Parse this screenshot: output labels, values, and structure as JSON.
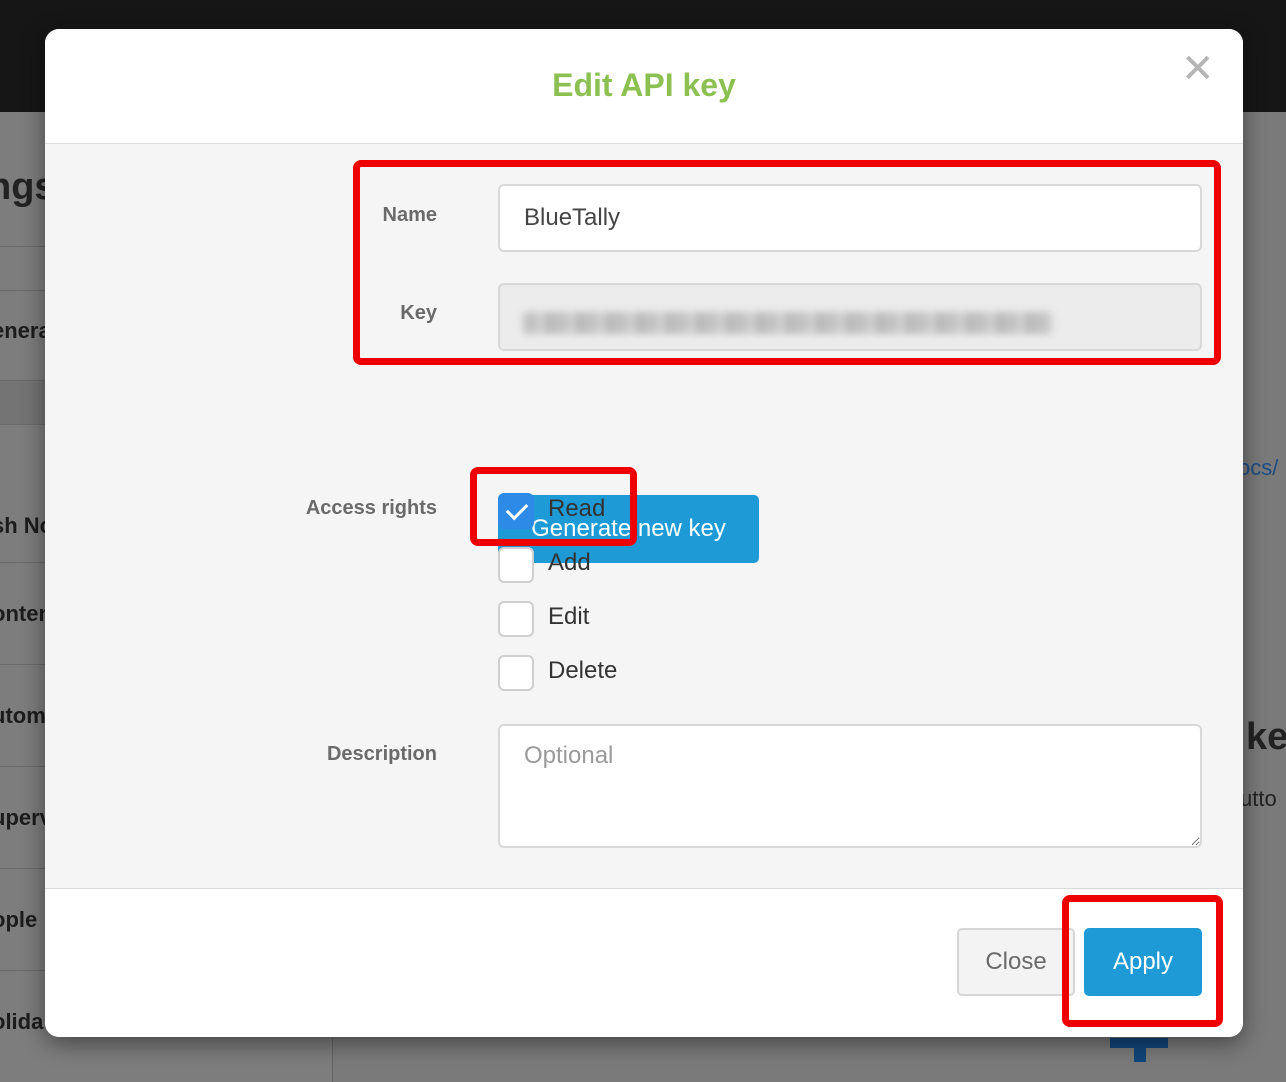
{
  "background": {
    "title_fragment": "ngs",
    "sidebar_items": [
      "enera",
      "sh No",
      "onten",
      "utom",
      "uperv",
      "ople",
      "olida"
    ],
    "link_fragment": "ocs/",
    "heading_fragment": "ke",
    "text_fragment": "utto"
  },
  "modal": {
    "title": "Edit API key",
    "close_glyph": "✕",
    "name_label": "Name",
    "name_value": "BlueTally",
    "key_label": "Key",
    "generate_label": "Generate new key",
    "access_label": "Access rights",
    "access_rights": [
      {
        "label": "Read",
        "checked": true
      },
      {
        "label": "Add",
        "checked": false
      },
      {
        "label": "Edit",
        "checked": false
      },
      {
        "label": "Delete",
        "checked": false
      }
    ],
    "description_label": "Description",
    "description_placeholder": "Optional",
    "close_label": "Close",
    "apply_label": "Apply"
  },
  "colors": {
    "title_green": "#8cc152",
    "primary_blue": "#1e9bd7",
    "checkbox_blue": "#2d8ae6",
    "annotation_red": "#ee0000"
  }
}
